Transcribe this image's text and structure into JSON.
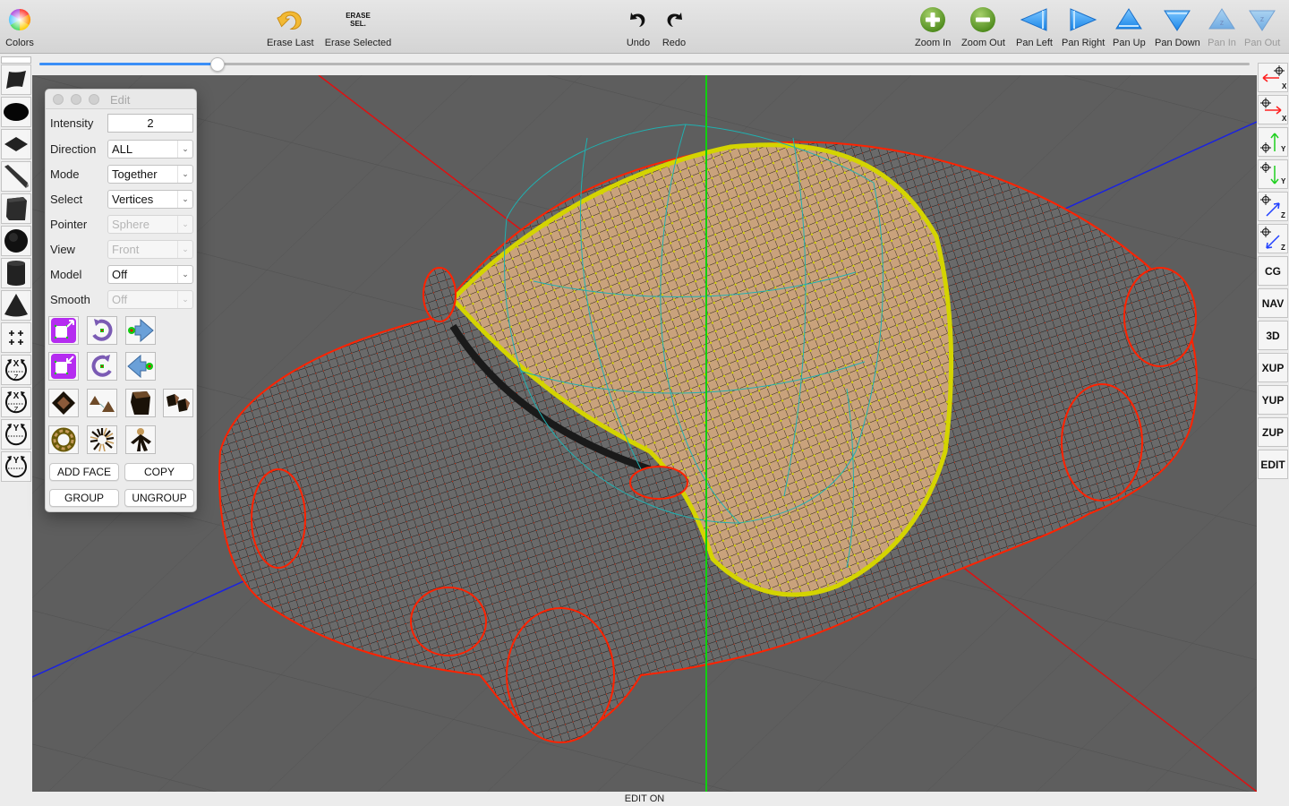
{
  "toolbar": {
    "colors": "Colors",
    "erase_last": "Erase Last",
    "erase_selected_icon_text": "ERASE SEL.",
    "erase_selected_icon_line1": "ERASE",
    "erase_selected_icon_line2": "SEL.",
    "erase_selected": "Erase Selected",
    "undo": "Undo",
    "redo": "Redo",
    "zoom_in": "Zoom In",
    "zoom_out": "Zoom Out",
    "pan_left": "Pan Left",
    "pan_right": "Pan Right",
    "pan_up": "Pan Up",
    "pan_down": "Pan Down",
    "pan_in": "Pan In",
    "pan_out": "Pan Out",
    "pan_in_glyph": "z",
    "pan_out_glyph": "z"
  },
  "slider": {
    "value_fraction": 0.147
  },
  "left_tools": [
    {
      "name": "surface-patch-tool"
    },
    {
      "name": "disc-tool"
    },
    {
      "name": "plane-tool"
    },
    {
      "name": "ramp-tool"
    },
    {
      "name": "cube-tool"
    },
    {
      "name": "sphere-tool"
    },
    {
      "name": "cylinder-tool"
    },
    {
      "name": "cone-tool"
    },
    {
      "name": "grid-points-tool",
      "glyph": "++\n++"
    },
    {
      "name": "rotate-xz-cw-tool",
      "top": "X",
      "bottom": "Z"
    },
    {
      "name": "rotate-xz-ccw-tool",
      "top": "X",
      "bottom": "Z"
    },
    {
      "name": "rotate-y-cw-tool",
      "top": "Y"
    },
    {
      "name": "rotate-y-ccw-tool",
      "top": "Y"
    }
  ],
  "right_tools": {
    "axis_buttons": [
      {
        "name": "move-neg-x",
        "axis": "X",
        "color": "#ff2020"
      },
      {
        "name": "move-pos-x",
        "axis": "X",
        "color": "#ff2020"
      },
      {
        "name": "move-pos-y",
        "axis": "Y",
        "color": "#20d020"
      },
      {
        "name": "move-neg-y",
        "axis": "Y",
        "color": "#20d020"
      },
      {
        "name": "move-pos-z",
        "axis": "Z",
        "color": "#2040ff"
      },
      {
        "name": "move-neg-z",
        "axis": "Z",
        "color": "#2040ff"
      }
    ],
    "text_buttons": [
      "CG",
      "NAV",
      "3D",
      "XUP",
      "YUP",
      "ZUP",
      "EDIT"
    ]
  },
  "edit_panel": {
    "title": "Edit",
    "fields": {
      "intensity": {
        "label": "Intensity",
        "value": "2"
      },
      "direction": {
        "label": "Direction",
        "value": "ALL",
        "enabled": true
      },
      "mode": {
        "label": "Mode",
        "value": "Together",
        "enabled": true
      },
      "select": {
        "label": "Select",
        "value": "Vertices",
        "enabled": true
      },
      "pointer": {
        "label": "Pointer",
        "value": "Sphere",
        "enabled": false
      },
      "view": {
        "label": "View",
        "value": "Front",
        "enabled": false
      },
      "model": {
        "label": "Model",
        "value": "Off",
        "enabled": true
      },
      "smooth": {
        "label": "Smooth",
        "value": "Off",
        "enabled": false
      }
    },
    "buttons": {
      "add_face": "ADD FACE",
      "copy": "COPY",
      "group": "GROUP",
      "ungroup": "UNGROUP"
    }
  },
  "viewport": {
    "colors": {
      "background": "#5e5e5e",
      "x_axis": "#e01010",
      "y_axis": "#10d010",
      "z_axis": "#1020e0",
      "mesh_wire": "#111111",
      "vertex_points": "#ff2200",
      "selection": "#d4d400",
      "pointer_sphere": "#20b0b0"
    }
  },
  "status": {
    "text": "EDIT ON"
  }
}
